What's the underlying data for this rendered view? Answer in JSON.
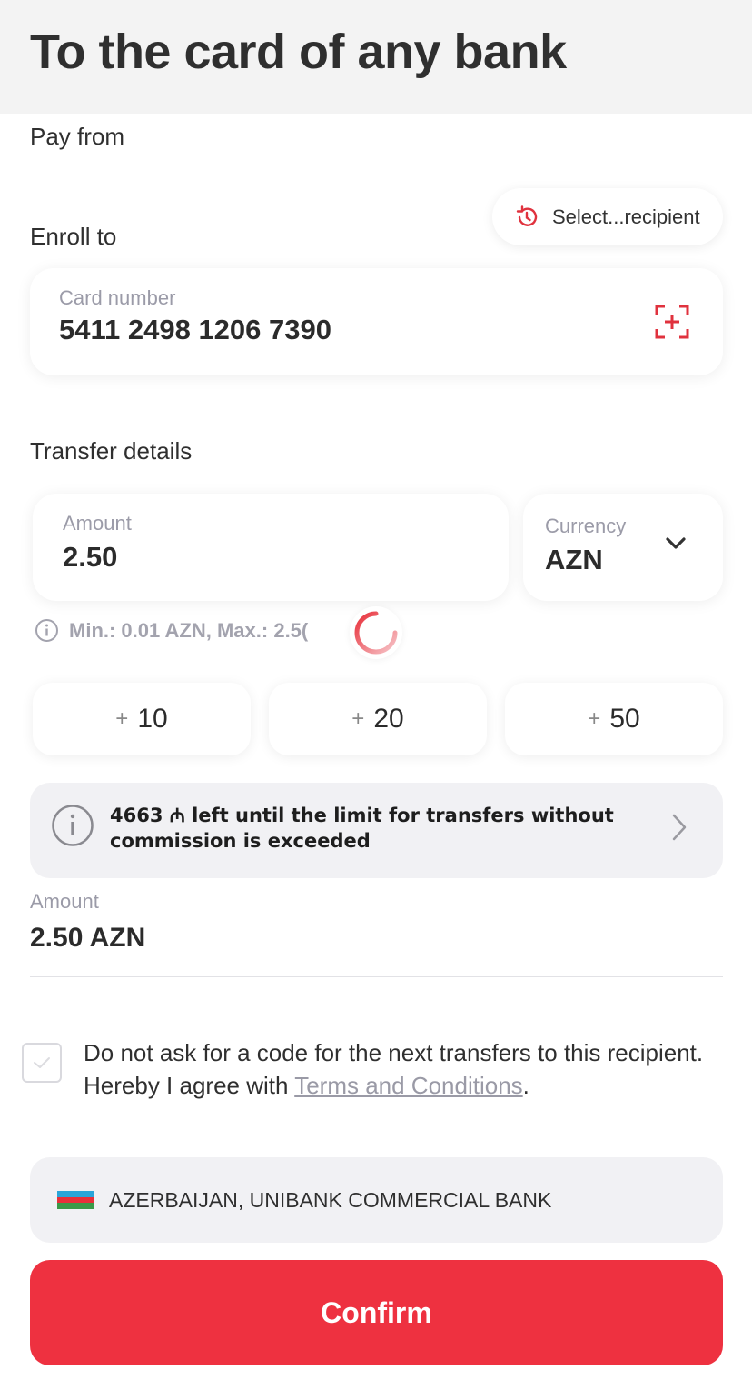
{
  "header": {
    "title": "To the card of any bank"
  },
  "pay_from": {
    "label": "Pay from"
  },
  "enroll_to": {
    "label": "Enroll to",
    "select_recipient": "Select...recipient"
  },
  "card": {
    "label": "Card number",
    "value": "5411 2498 1206 7390"
  },
  "transfer": {
    "label": "Transfer details",
    "amount_label": "Amount",
    "amount_value": "2.50",
    "currency_label": "Currency",
    "currency_value": "AZN",
    "hint": "Min.: 0.01 AZN, Max.: 2.5("
  },
  "quick_add": [
    {
      "plus": "+",
      "value": "10"
    },
    {
      "plus": "+",
      "value": "20"
    },
    {
      "plus": "+",
      "value": "50"
    }
  ],
  "limit_info": {
    "text": "4663 ₼ left until the limit for transfers without commission is exceeded"
  },
  "summary": {
    "label": "Amount",
    "value": "2.50 AZN"
  },
  "consent": {
    "text": "Do not ask for a code for the next transfers to this recipient. Hereby I agree with ",
    "link": "Terms and Conditions",
    "suffix": ".",
    "checked": false
  },
  "bank": {
    "name": "AZERBAIJAN, UNIBANK COMMERCIAL BANK",
    "flag": "azerbaijan-flag"
  },
  "confirm_button": {
    "label": "Confirm"
  },
  "colors": {
    "accent": "#ee3140",
    "muted": "#9b9ba8",
    "banner": "#f1f1f4"
  },
  "icons": {
    "history": "history-icon",
    "scan": "card-scan-icon",
    "dropdown": "chevron-down-icon",
    "info": "info-icon",
    "arrow": "chevron-right-icon",
    "check": "check-icon",
    "spinner": "loading-spinner"
  }
}
